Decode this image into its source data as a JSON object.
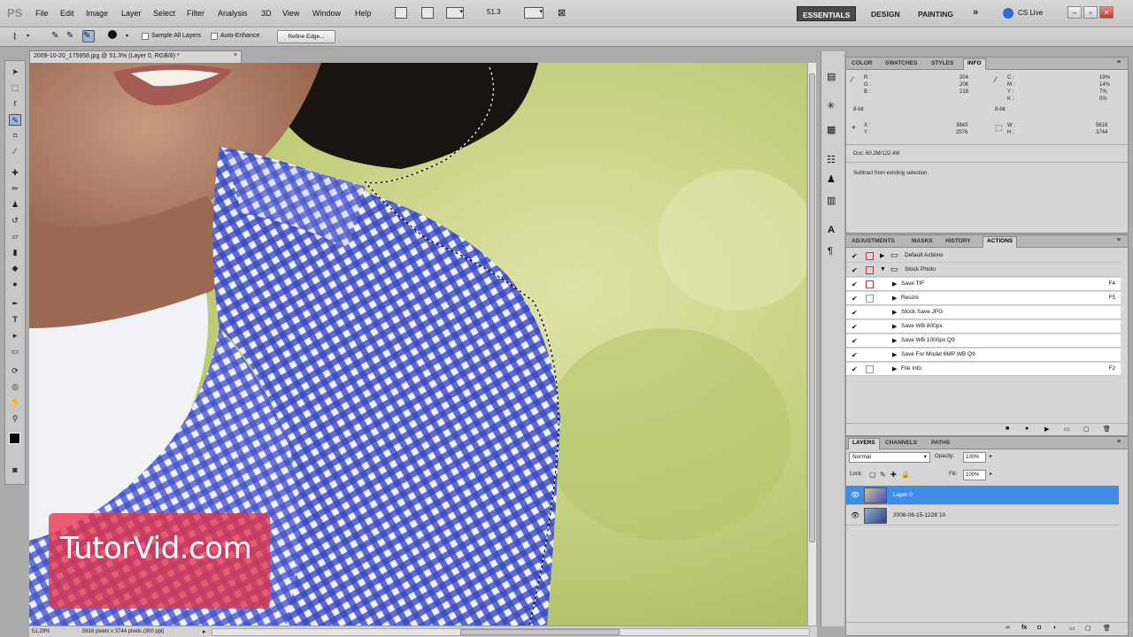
{
  "app": {
    "logo": "PS"
  },
  "menu": [
    "File",
    "Edit",
    "Image",
    "Layer",
    "Select",
    "Filter",
    "Analysis",
    "3D",
    "View",
    "Window",
    "Help"
  ],
  "appbar": {
    "zoom": "51.3"
  },
  "workspaces": {
    "essentials": "ESSENTIALS",
    "design": "DESIGN",
    "painting": "PAINTING",
    "more": "»",
    "cslive": "CS Live"
  },
  "options": {
    "sample_all_layers": "Sample All Layers",
    "auto_enhance": "Auto-Enhance",
    "refine_edge": "Refine Edge..."
  },
  "document": {
    "tab_title": "2009-10-20_175958.jpg @ 51.3% (Layer 0, RGB/8) *",
    "zoom_status": "51.29%",
    "size_status": "5616 pixels x 3744 pixels (300 ppi)"
  },
  "info_panel": {
    "tabs": [
      "COLOR",
      "SWATCHES",
      "STYLES",
      "INFO"
    ],
    "rgb_labels": [
      "R :",
      "G :",
      "B :"
    ],
    "rgb_values": [
      "204",
      "206",
      "218"
    ],
    "bit_left": "8-bit",
    "cmyk_labels": [
      "C :",
      "M :",
      "Y :",
      "K :"
    ],
    "cmyk_values": [
      "19%",
      "14%",
      "7%",
      "0%"
    ],
    "bit_right": "8-bit",
    "x_label": "X :",
    "x_value": "3843",
    "y_label": "Y :",
    "y_value": "2576",
    "w_label": "W :",
    "w_value": "5616",
    "h_label": "H :",
    "h_value": "3744",
    "doc": "Doc: 60.2M/122.4M",
    "hint": "Subtract from existing selection."
  },
  "actions_panel": {
    "tabs": [
      "ADJUSTMENTS",
      "MASKS",
      "HISTORY",
      "ACTIONS"
    ],
    "rows": [
      {
        "name": "Default Actions",
        "key": ""
      },
      {
        "name": "Stock Photo",
        "key": ""
      },
      {
        "name": "Save TIF",
        "key": "F4"
      },
      {
        "name": "Resize",
        "key": "F5"
      },
      {
        "name": "Stock Save JPG",
        "key": ""
      },
      {
        "name": "Save WB 800px",
        "key": ""
      },
      {
        "name": "Save WB 1000px Q9",
        "key": ""
      },
      {
        "name": "Save For Model 6MP WB Q9",
        "key": ""
      },
      {
        "name": "File Info",
        "key": "F2"
      }
    ]
  },
  "layers_panel": {
    "tabs": [
      "LAYERS",
      "CHANNELS",
      "PATHS"
    ],
    "blend_mode": "Normal",
    "opacity_label": "Opacity:",
    "opacity_value": "100%",
    "lock_label": "Lock:",
    "fill_label": "Fill:",
    "fill_value": "100%",
    "layers": [
      {
        "name": "Layer 0"
      },
      {
        "name": "2008-06-15-1228`10"
      }
    ]
  },
  "watermark": {
    "text": "TutorVid.com"
  },
  "colors": {
    "accent": "#3d8ee6",
    "panel": "#d6d6d6",
    "chrome": "#c8c8c8"
  }
}
